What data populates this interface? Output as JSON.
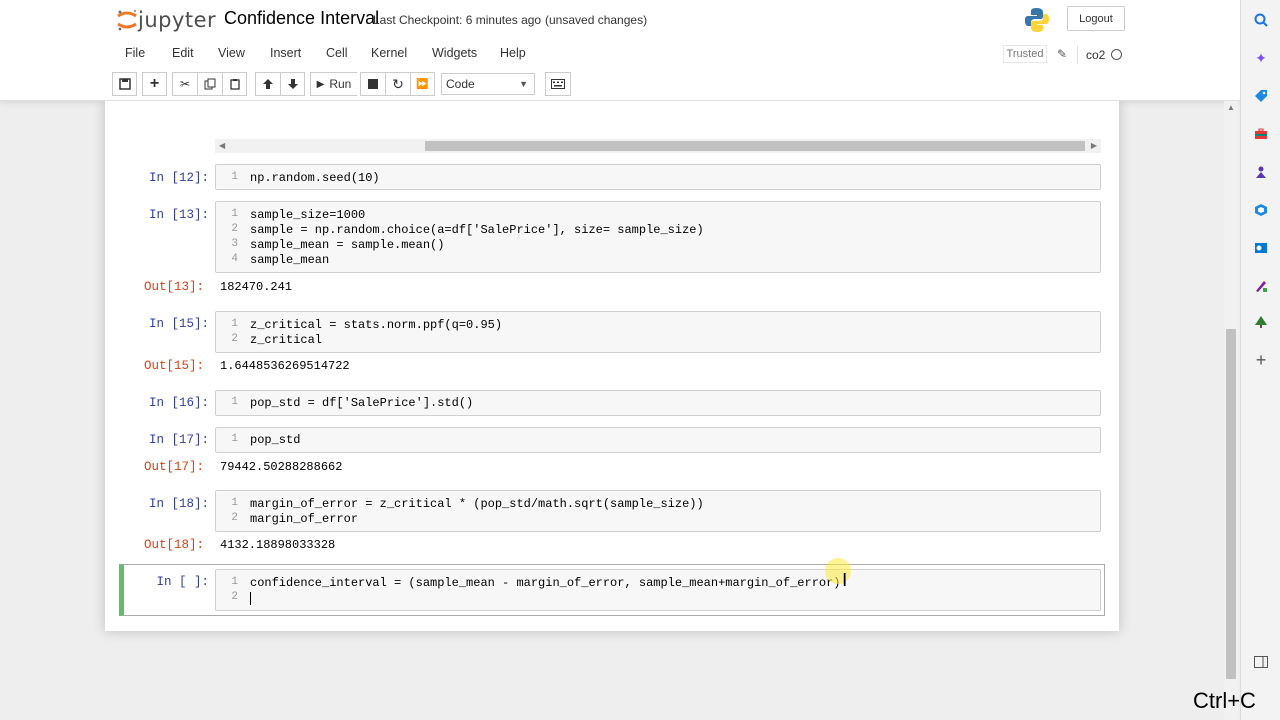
{
  "header": {
    "logo_text": "jupyter",
    "notebook_title": "Confidence Interval",
    "checkpoint": "Last Checkpoint: 6 minutes ago",
    "unsaved": "(unsaved changes)",
    "logout_label": "Logout",
    "trusted_label": "Trusted",
    "kernel_name": "co2"
  },
  "menu": [
    "File",
    "Edit",
    "View",
    "Insert",
    "Cell",
    "Kernel",
    "Widgets",
    "Help"
  ],
  "toolbar": {
    "run_label": "Run",
    "cell_type": "Code"
  },
  "cells": {
    "c12": {
      "prompt": "In [12]:",
      "lines": [
        "np.random.seed(10)"
      ]
    },
    "c13": {
      "prompt": "In [13]:",
      "lines": [
        "sample_size=1000",
        "sample = np.random.choice(a=df['SalePrice'], size= sample_size)",
        "sample_mean = sample.mean()",
        "sample_mean"
      ],
      "out_prompt": "Out[13]:",
      "output": "182470.241"
    },
    "c15": {
      "prompt": "In [15]:",
      "lines": [
        "z_critical = stats.norm.ppf(q=0.95)",
        "z_critical"
      ],
      "out_prompt": "Out[15]:",
      "output": "1.6448536269514722"
    },
    "c16": {
      "prompt": "In [16]:",
      "lines": [
        "pop_std = df['SalePrice'].std()"
      ]
    },
    "c17": {
      "prompt": "In [17]:",
      "lines": [
        "pop_std"
      ],
      "out_prompt": "Out[17]:",
      "output": "79442.50288288662"
    },
    "c18": {
      "prompt": "In [18]:",
      "lines": [
        "margin_of_error = z_critical * (pop_std/math.sqrt(sample_size))",
        "margin_of_error"
      ],
      "out_prompt": "Out[18]:",
      "output": "4132.18898033328"
    },
    "cnew": {
      "prompt": "In [ ]:",
      "lines": [
        "confidence_interval = (sample_mean - margin_of_error, sample_mean+margin_of_error)",
        ""
      ]
    }
  },
  "line_numbers": [
    "1",
    "2",
    "3",
    "4"
  ],
  "overlay": {
    "shortcut_text": "Ctrl+C"
  }
}
